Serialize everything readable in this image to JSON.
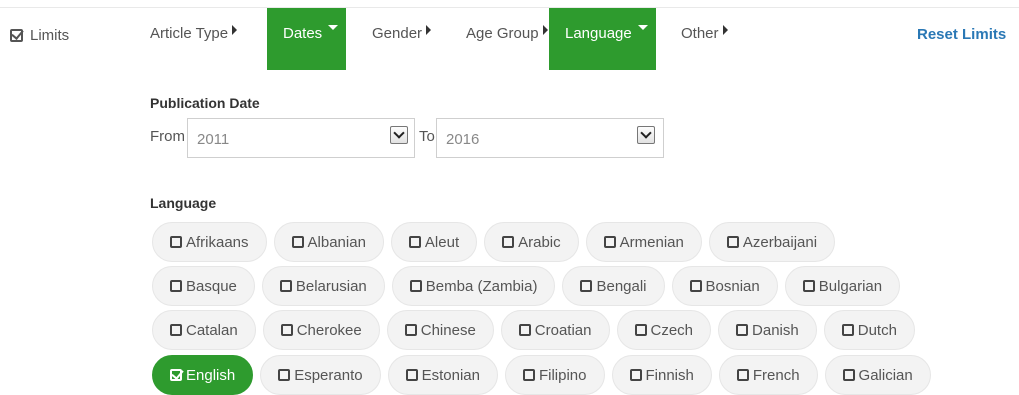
{
  "limits": {
    "label": "Limits",
    "icon": "checkbox-checked-icon"
  },
  "tabs": [
    {
      "label": "Article Type",
      "active": false,
      "caret": "right"
    },
    {
      "label": "Dates",
      "active": true,
      "caret": "down"
    },
    {
      "label": "Gender",
      "active": false,
      "caret": "right"
    },
    {
      "label": "Age Group",
      "active": false,
      "caret": "right"
    },
    {
      "label": "Language",
      "active": true,
      "caret": "down"
    },
    {
      "label": "Other",
      "active": false,
      "caret": "right"
    }
  ],
  "reset_label": "Reset Limits",
  "publication_date": {
    "title": "Publication Date",
    "from_label": "From",
    "from_value": "2011",
    "to_label": "To",
    "to_value": "2016"
  },
  "language": {
    "title": "Language",
    "rows": [
      [
        {
          "label": "Afrikaans",
          "checked": false
        },
        {
          "label": "Albanian",
          "checked": false
        },
        {
          "label": "Aleut",
          "checked": false
        },
        {
          "label": "Arabic",
          "checked": false
        },
        {
          "label": "Armenian",
          "checked": false
        },
        {
          "label": "Azerbaijani",
          "checked": false
        }
      ],
      [
        {
          "label": "Basque",
          "checked": false
        },
        {
          "label": "Belarusian",
          "checked": false
        },
        {
          "label": "Bemba (Zambia)",
          "checked": false
        },
        {
          "label": "Bengali",
          "checked": false
        },
        {
          "label": "Bosnian",
          "checked": false
        },
        {
          "label": "Bulgarian",
          "checked": false
        }
      ],
      [
        {
          "label": "Catalan",
          "checked": false
        },
        {
          "label": "Cherokee",
          "checked": false
        },
        {
          "label": "Chinese",
          "checked": false
        },
        {
          "label": "Croatian",
          "checked": false
        },
        {
          "label": "Czech",
          "checked": false
        },
        {
          "label": "Danish",
          "checked": false
        },
        {
          "label": "Dutch",
          "checked": false
        }
      ],
      [
        {
          "label": "English",
          "checked": true
        },
        {
          "label": "Esperanto",
          "checked": false
        },
        {
          "label": "Estonian",
          "checked": false
        },
        {
          "label": "Filipino",
          "checked": false
        },
        {
          "label": "Finnish",
          "checked": false
        },
        {
          "label": "French",
          "checked": false
        },
        {
          "label": "Galician",
          "checked": false
        }
      ]
    ]
  },
  "colors": {
    "active_green": "#2e9b2e",
    "link_blue": "#2a78b5"
  }
}
